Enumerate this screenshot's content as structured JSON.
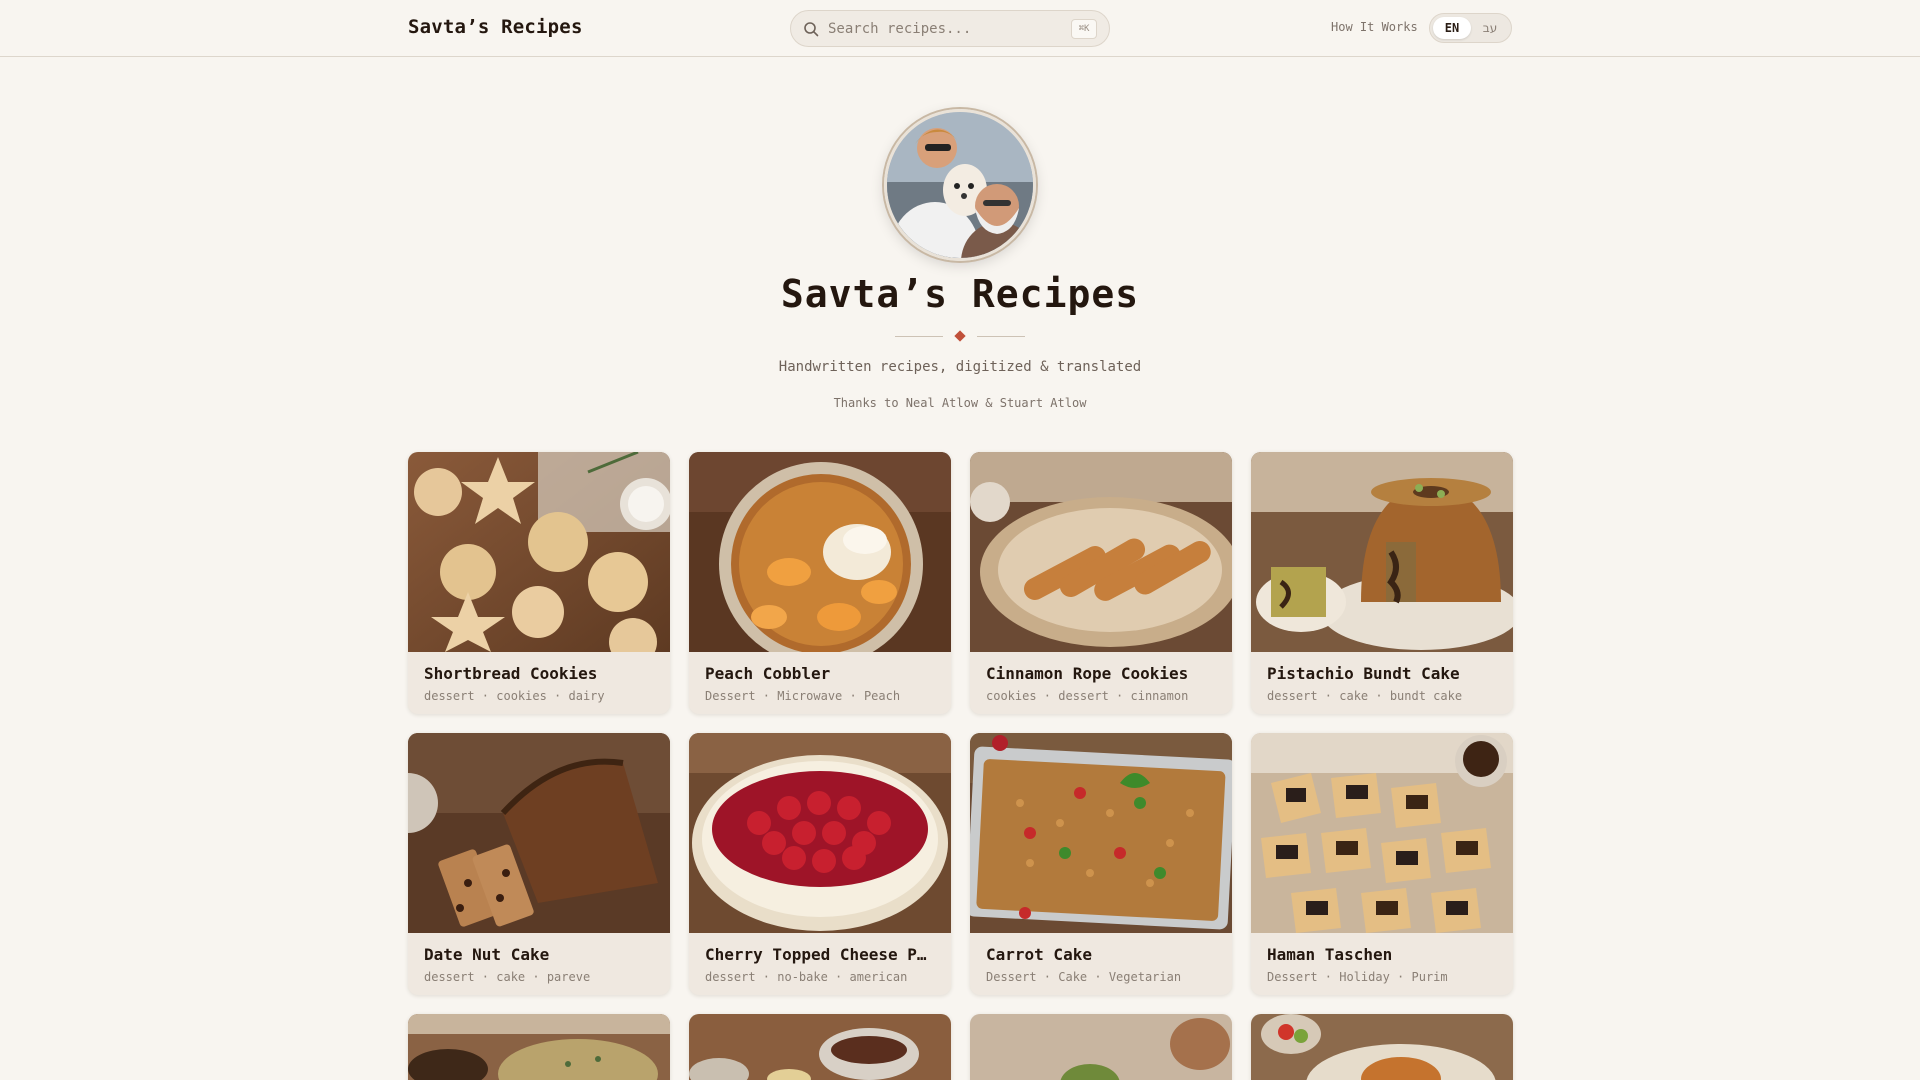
{
  "header": {
    "brand": "Savta’s Recipes",
    "search_placeholder": "Search recipes...",
    "search_shortcut": "⌘K",
    "how_it_works": "How It Works",
    "lang_en": "EN",
    "lang_he": "עב"
  },
  "hero": {
    "title": "Savta’s Recipes",
    "subtitle": "Handwritten recipes, digitized & translated",
    "thanks": "Thanks to Neal Atlow & Stuart Atlow"
  },
  "recipes": [
    {
      "name": "Shortbread Cookies",
      "tags": "dessert · cookies · dairy"
    },
    {
      "name": "Peach Cobbler",
      "tags": "Dessert · Microwave · Peach"
    },
    {
      "name": "Cinnamon Rope Cookies",
      "tags": "cookies · dessert · cinnamon"
    },
    {
      "name": "Pistachio Bundt Cake",
      "tags": "dessert · cake · bundt cake"
    },
    {
      "name": "Date Nut Cake",
      "tags": "dessert · cake · pareve"
    },
    {
      "name": "Cherry Topped Cheese P…",
      "tags": "dessert · no-bake · american"
    },
    {
      "name": "Carrot Cake",
      "tags": "Dessert · Cake · Vegetarian"
    },
    {
      "name": "Haman Taschen",
      "tags": "Dessert · Holiday · Purim"
    }
  ],
  "colors": {
    "background": "#f8f5f0",
    "accent": "#c0503a",
    "text": "#24170f"
  }
}
